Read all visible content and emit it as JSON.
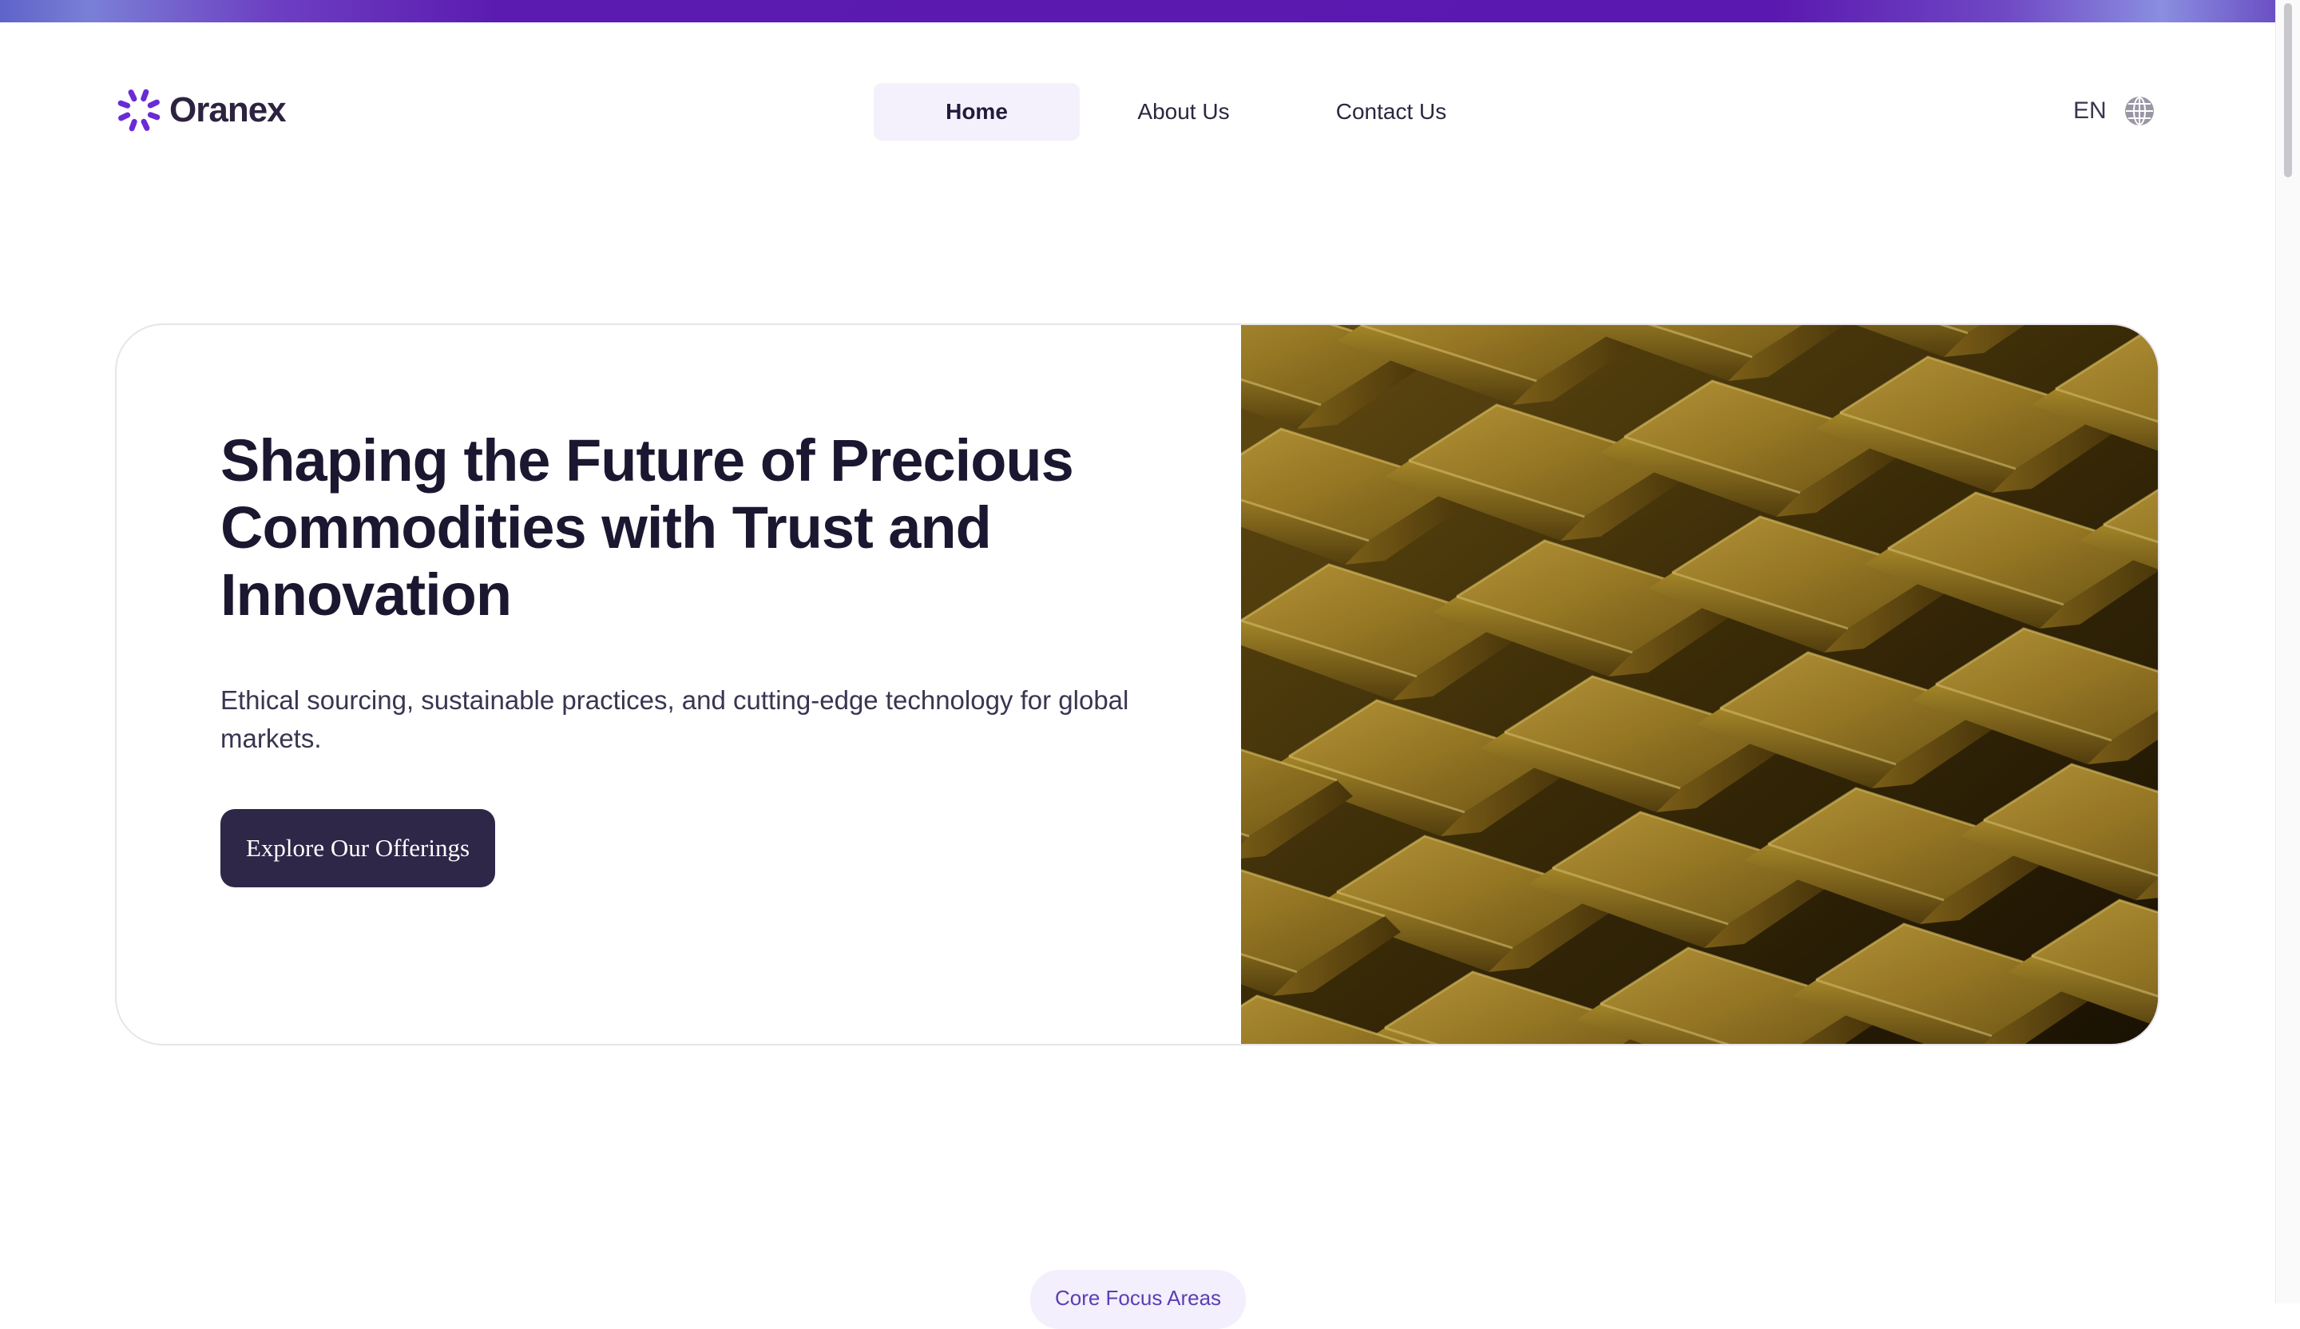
{
  "brand": {
    "name": "Oranex",
    "accent": "#5b18b0",
    "dark_button": "#2f2748"
  },
  "nav": {
    "items": [
      {
        "label": "Home",
        "active": true
      },
      {
        "label": "About Us",
        "active": false
      },
      {
        "label": "Contact Us",
        "active": false
      }
    ]
  },
  "language": {
    "label": "EN",
    "icon": "globe-icon"
  },
  "hero": {
    "title": "Shaping the Future of Precious Commodities with Trust and Innovation",
    "subtitle": "Ethical sourcing, sustainable practices, and cutting-edge technology for global markets.",
    "cta_label": "Explore Our Offerings",
    "image_subject": "gold-bars"
  },
  "section_badge": {
    "label": "Core Focus Areas"
  }
}
